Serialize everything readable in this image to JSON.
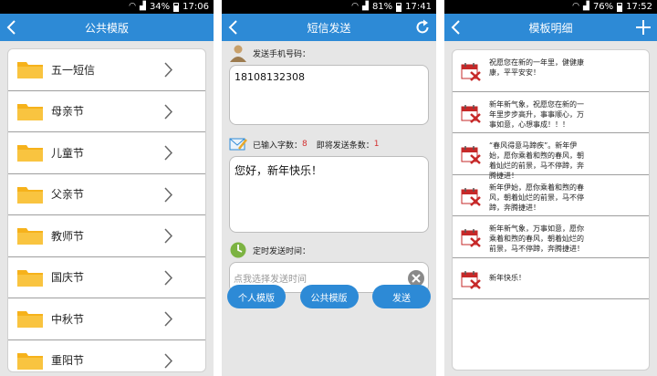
{
  "panel1": {
    "status": {
      "battery": "34%",
      "time": "17:06"
    },
    "title": "公共模版",
    "items": [
      {
        "label": "五一短信"
      },
      {
        "label": "母亲节"
      },
      {
        "label": "儿童节"
      },
      {
        "label": "父亲节"
      },
      {
        "label": "教师节"
      },
      {
        "label": "国庆节"
      },
      {
        "label": "中秋节"
      },
      {
        "label": "重阳节"
      }
    ]
  },
  "panel2": {
    "status": {
      "battery": "81%",
      "time": "17:41"
    },
    "title": "短信发送",
    "phone_label": "发送手机号码：",
    "phone_value": "18108132308",
    "count_label": "已输入字数：",
    "count_value": "8",
    "send_count_label": "即将发送条数：",
    "send_count_value": "1",
    "message": "您好，新年快乐！",
    "timer_label": "定时发送时间：",
    "timer_placeholder": "点我选择发送时间",
    "buttons": {
      "personal": "个人模版",
      "public": "公共模版",
      "send": "发送"
    }
  },
  "panel3": {
    "status": {
      "battery": "76%",
      "time": "17:52"
    },
    "title": "模板明细",
    "items": [
      {
        "text": "祝愿您在新的一年里，健健康康，平平安安！"
      },
      {
        "text": "新年新气象，祝愿您在新的一年里步步高升，事事顺心，万事如意，心想事成！！！"
      },
      {
        "text": "“春风得意马蹄疾”。新年伊始，愿你乘着和煦的春风，朝着灿烂的前景，马不停蹄，奔腾捷进！"
      },
      {
        "text": "新年伊始，愿你乘着和煦的春风，朝着灿烂的前景，马不停蹄，奔腾捷进！"
      },
      {
        "text": "新年新气象，万事如意，愿你乘着和煦的春风，朝着灿烂的前景，马不停蹄，奔腾捷进！"
      },
      {
        "text": "新年快乐！"
      }
    ]
  },
  "colors": {
    "accent": "#2d8ad6",
    "highlight": "#d32f2f"
  }
}
